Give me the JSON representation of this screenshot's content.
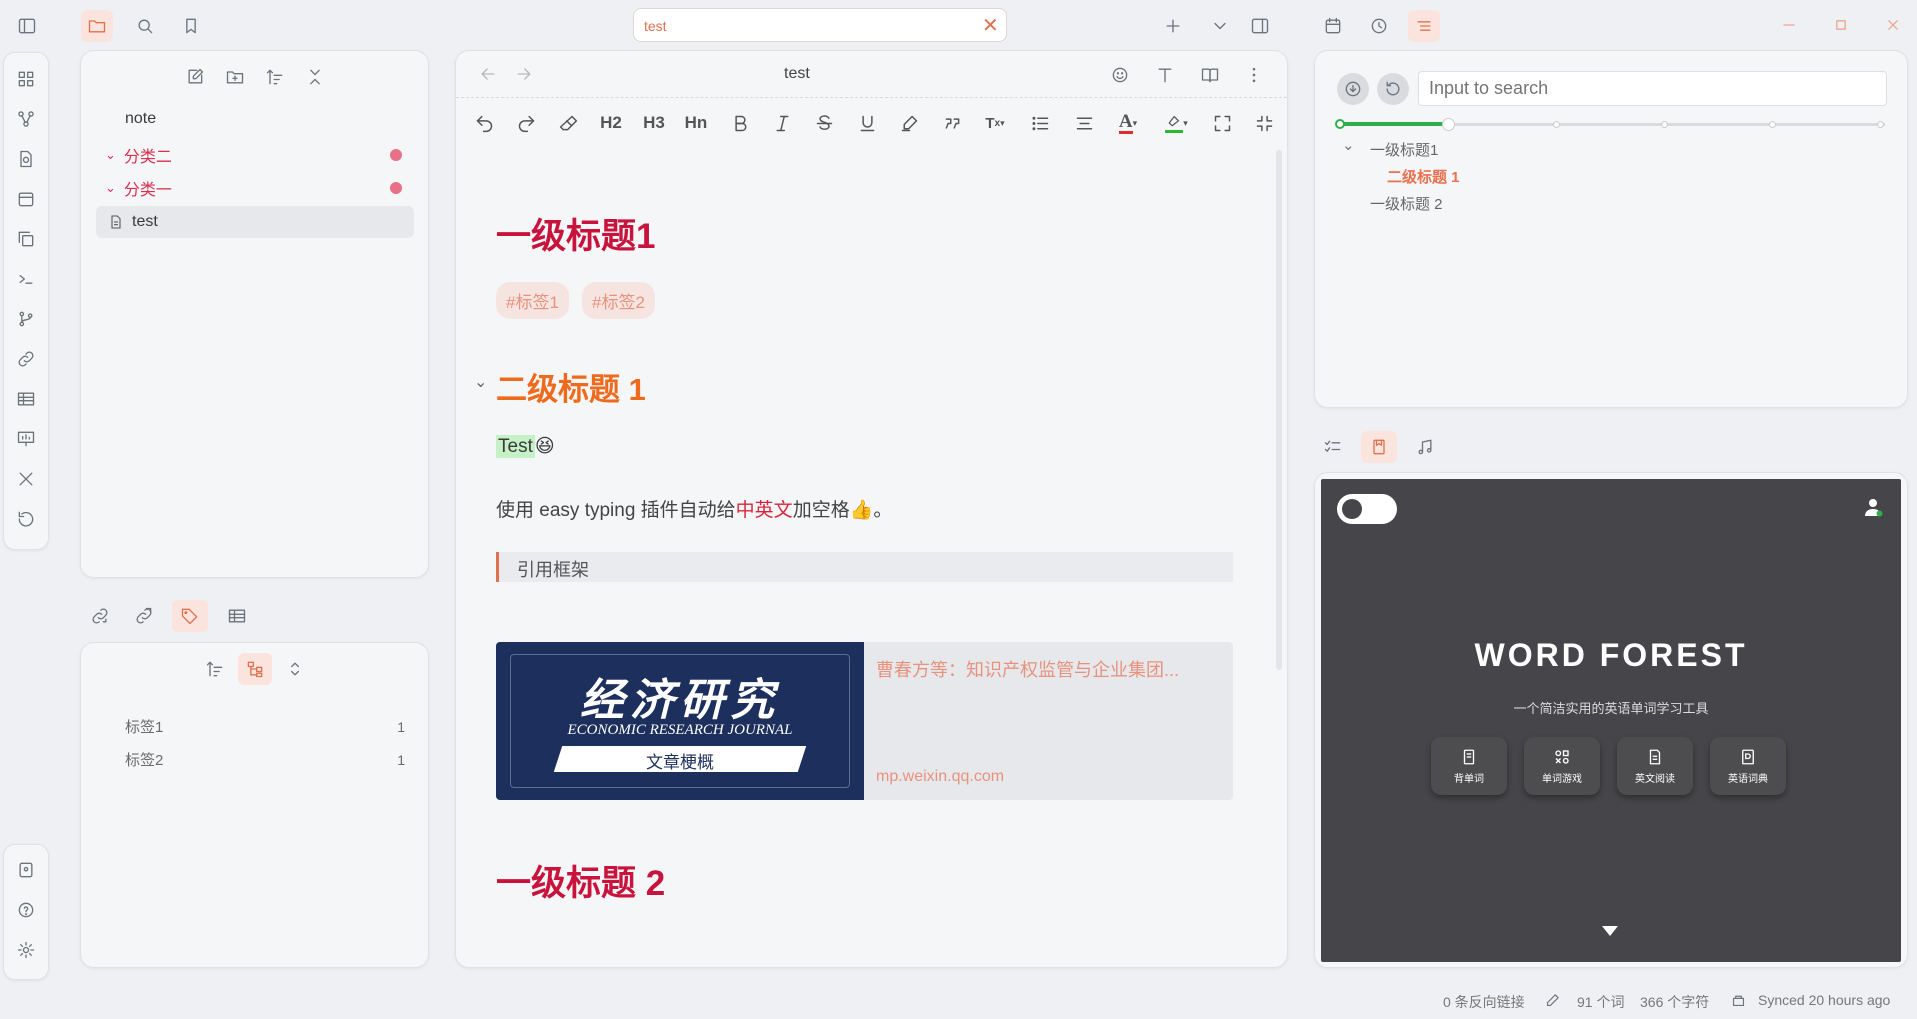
{
  "tab": {
    "title": "test"
  },
  "file_tree": {
    "items": [
      {
        "label": "note"
      },
      {
        "label": "分类二"
      },
      {
        "label": "分类一"
      },
      {
        "label": "test"
      }
    ]
  },
  "tags_panel": {
    "items": [
      {
        "label": "标签1",
        "count": "1"
      },
      {
        "label": "标签2",
        "count": "1"
      }
    ]
  },
  "editor": {
    "title": "test",
    "toolbar": {
      "h2": "H2",
      "h3": "H3",
      "hn": "Hn"
    },
    "h1_first": "一级标题1",
    "tags": [
      "#标签1",
      "#标签2"
    ],
    "h2": "二级标题 1",
    "test_text": "Test",
    "test_emoji": "😆",
    "para_before": "使用 easy typing 插件自动给",
    "para_red": "中英文",
    "para_after": "加空格👍。",
    "quote": "引用框架",
    "card": {
      "logo_cn": "经济研究",
      "logo_en": "ECONOMIC RESEARCH JOURNAL",
      "banner": "文章梗概",
      "title": "曹春方等：知识产权监管与企业集团...",
      "url": "mp.weixin.qq.com"
    },
    "h1_second": "一级标题 2"
  },
  "outline": {
    "search_placeholder": "Input to search",
    "items": [
      {
        "label": "一级标题1"
      },
      {
        "label": "二级标题 1"
      },
      {
        "label": "一级标题 2"
      }
    ]
  },
  "word_forest": {
    "title": "WORD FOREST",
    "subtitle": "一个简洁实用的英语单词学习工具",
    "buttons": [
      "背单词",
      "单词游戏",
      "英文阅读",
      "英语词典"
    ]
  },
  "status_bar": {
    "backlinks": "0 条反向链接",
    "words": "91 个词",
    "chars": "366 个字符",
    "sync": "Synced 20 hours ago"
  },
  "colors": {
    "accent": "#e0714f",
    "h1": "#c8143c",
    "h2": "#ee6a1c",
    "tree_red": "#d8314e"
  }
}
